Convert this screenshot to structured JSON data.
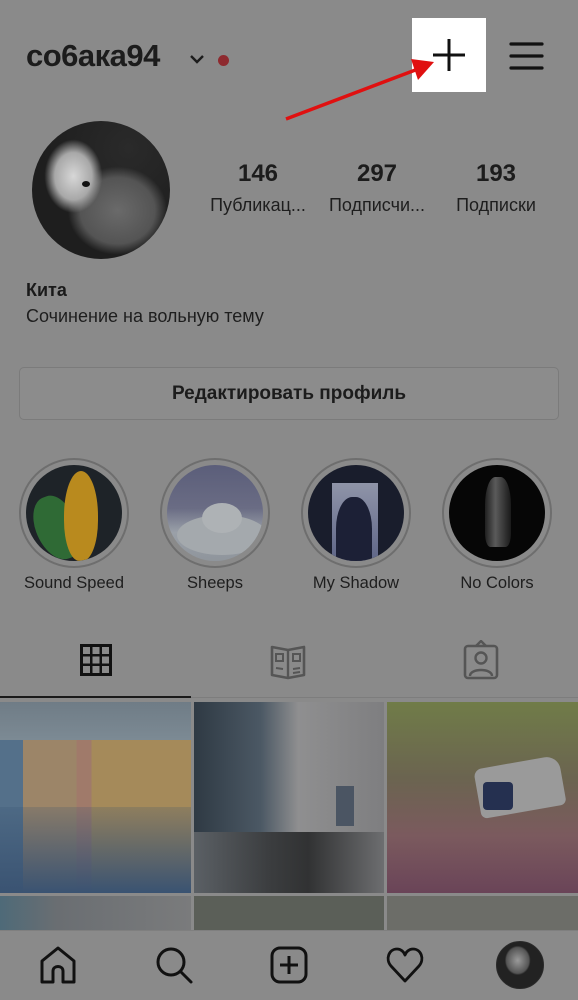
{
  "header": {
    "username": "со6ака94",
    "account_switcher_icon": "chevron-down-icon",
    "notification_dot_color": "#8e2a2f",
    "new_post_icon": "plus-icon",
    "menu_icon": "hamburger-menu-icon",
    "annotation_arrow_color": "#e01010"
  },
  "profile": {
    "avatar_icon": "profile-photo-cat",
    "stats": [
      {
        "value": "146",
        "label": "Публикац..."
      },
      {
        "value": "297",
        "label": "Подписчи..."
      },
      {
        "value": "193",
        "label": "Подписки"
      }
    ],
    "display_name": "Кита",
    "bio": "Сочинение на вольную тему",
    "edit_button_label": "Редактировать профиль"
  },
  "highlights": [
    {
      "label": "Sound Speed"
    },
    {
      "label": "Sheeps"
    },
    {
      "label": "My Shadow"
    },
    {
      "label": "No Colors"
    }
  ],
  "tabs": [
    {
      "name": "grid",
      "icon": "grid-icon",
      "active": true
    },
    {
      "name": "guides",
      "icon": "guide-book-icon",
      "active": false
    },
    {
      "name": "tagged",
      "icon": "tagged-person-icon",
      "active": false
    }
  ],
  "posts": [
    {
      "alt": "apartment buildings in winter"
    },
    {
      "alt": "snowy street with trees"
    },
    {
      "alt": "security camera"
    },
    {
      "alt": "post 4"
    },
    {
      "alt": "post 5"
    },
    {
      "alt": "post 6"
    }
  ],
  "bottom_nav": [
    {
      "name": "home",
      "icon": "home-icon"
    },
    {
      "name": "search",
      "icon": "search-icon"
    },
    {
      "name": "new-post",
      "icon": "add-square-icon"
    },
    {
      "name": "activity",
      "icon": "heart-icon"
    },
    {
      "name": "profile",
      "icon": "profile-avatar-icon"
    }
  ]
}
